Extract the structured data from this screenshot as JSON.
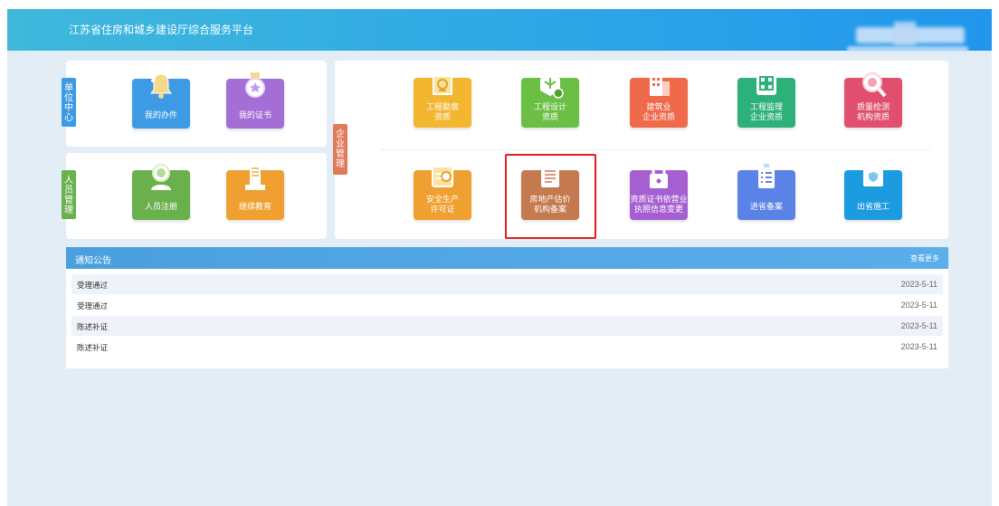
{
  "header": {
    "title": "江苏省住房和城乡建设厅综合服务平台"
  },
  "unit_center": {
    "tab_label": "单位中心",
    "items": [
      {
        "label": "我的办件",
        "color": "#3d9be6",
        "icon": "bell-icon"
      },
      {
        "label": "我的证书",
        "color": "#a36fd6",
        "icon": "medal-icon"
      }
    ]
  },
  "personnel": {
    "tab_label": "人员管理",
    "items": [
      {
        "label": "人员注册",
        "color": "#6ab04c",
        "icon": "user-icon"
      },
      {
        "label": "继续教育",
        "color": "#f0a030",
        "icon": "building-icon"
      }
    ]
  },
  "enterprise": {
    "tab_label": "企业管理",
    "row1": [
      {
        "line1": "工程勘察",
        "line2": "资质",
        "color": "#f2b630",
        "icon": "survey-icon"
      },
      {
        "line1": "工程设计",
        "line2": "资质",
        "color": "#6bbf45",
        "icon": "design-icon"
      },
      {
        "line1": "建筑业",
        "line2": "企业资质",
        "color": "#ee6a4a",
        "icon": "construction-icon"
      },
      {
        "line1": "工程监理",
        "line2": "企业资质",
        "color": "#2eb07a",
        "icon": "supervision-icon"
      },
      {
        "line1": "质量检测",
        "line2": "机构资质",
        "color": "#e0506e",
        "icon": "inspection-icon"
      }
    ],
    "row2": [
      {
        "line1": "安全生产",
        "line2": "许可证",
        "color": "#f0a030",
        "icon": "safety-icon"
      },
      {
        "line1": "房地产估价",
        "line2": "机构备案",
        "color": "#c47a4e",
        "icon": "appraisal-icon"
      },
      {
        "line1": "资质证书依营业",
        "line2": "执照信息变更",
        "color": "#a55fd0",
        "icon": "license-change-icon"
      },
      {
        "line1": "进省备案",
        "line2": "",
        "color": "#5b82e6",
        "icon": "checklist-icon"
      },
      {
        "line1": "出省施工",
        "line2": "",
        "color": "#1d9be0",
        "icon": "certificate-icon"
      }
    ]
  },
  "notices": {
    "title": "通知公告",
    "more": "查看更多",
    "rows": [
      {
        "text": "受理通过",
        "date": "2023-5-11"
      },
      {
        "text": "受理通过",
        "date": "2023-5-11"
      },
      {
        "text": "陈述补证",
        "date": "2023-5-11"
      },
      {
        "text": "陈述补证",
        "date": "2023-5-11"
      }
    ]
  },
  "colors": {
    "header_start": "#3fb8dc",
    "header_end": "#2196ec",
    "highlight_border": "#e02020",
    "unit_tab": "#3d9be6",
    "personnel_tab": "#6ab04c",
    "enterprise_tab": "#e07a5a"
  }
}
